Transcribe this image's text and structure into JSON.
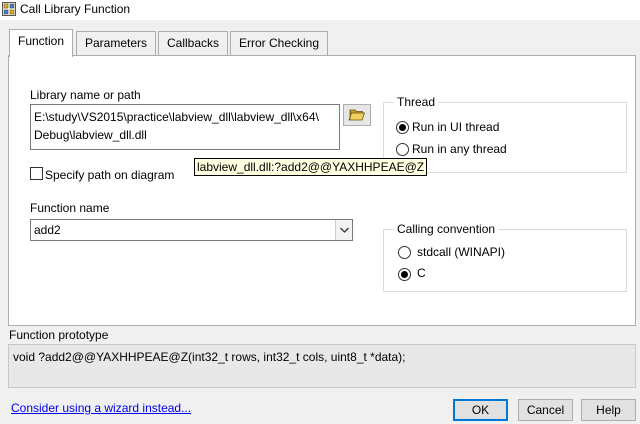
{
  "window": {
    "title": "Call Library Function",
    "icon": "labview-call-library-icon"
  },
  "tabs": [
    {
      "label": "Function",
      "active": true
    },
    {
      "label": "Parameters",
      "active": false
    },
    {
      "label": "Callbacks",
      "active": false
    },
    {
      "label": "Error Checking",
      "active": false
    }
  ],
  "library": {
    "label": "Library name or path",
    "path_line1": "E:\\study\\VS2015\\practice\\labview_dll\\labview_dll\\x64\\",
    "path_line2": "Debug\\labview_dll.dll",
    "browse_icon": "folder-open-icon",
    "tooltip": "labview_dll.dll:?add2@@YAXHHPEAE@Z"
  },
  "specify_path": {
    "label": "Specify path on diagram",
    "checked": false
  },
  "function_name": {
    "label": "Function name",
    "value": "add2"
  },
  "thread": {
    "title": "Thread",
    "options": [
      {
        "label": "Run in UI thread",
        "checked": true
      },
      {
        "label": "Run in any thread",
        "checked": false
      }
    ]
  },
  "calling_convention": {
    "title": "Calling convention",
    "options": [
      {
        "label": "stdcall (WINAPI)",
        "checked": false
      },
      {
        "label": "C",
        "checked": true
      }
    ]
  },
  "prototype": {
    "label": "Function prototype",
    "value": "void  ?add2@@YAXHHPEAE@Z(int32_t rows, int32_t cols, uint8_t *data);"
  },
  "footer": {
    "wizard_link": "Consider using a wizard instead...",
    "ok_label": "OK",
    "cancel_label": "Cancel",
    "help_label": "Help"
  },
  "colors": {
    "default_button_border": "#0078d7",
    "link": "#0000ee",
    "tooltip_bg": "#ffffe1"
  }
}
